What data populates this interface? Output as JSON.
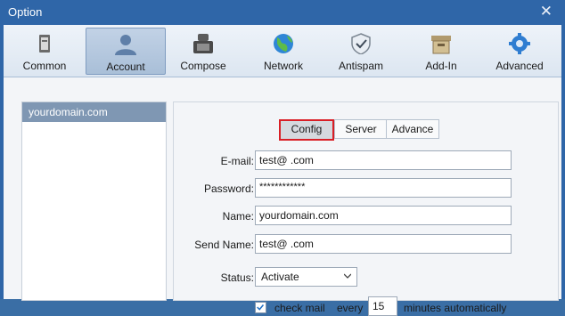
{
  "window": {
    "title": "Option"
  },
  "toolbar": {
    "items": [
      {
        "label": "Common",
        "icon": "common-icon"
      },
      {
        "label": "Account",
        "icon": "account-icon",
        "active": true
      },
      {
        "label": "Compose",
        "icon": "compose-icon"
      },
      {
        "label": "Network",
        "icon": "network-globe-icon"
      },
      {
        "label": "Antispam",
        "icon": "shield-icon"
      },
      {
        "label": "Add-In",
        "icon": "box-icon"
      },
      {
        "label": "Advanced",
        "icon": "gear-icon"
      }
    ]
  },
  "accounts": {
    "items": [
      "yourdomain.com"
    ]
  },
  "tabs": {
    "config": "Config",
    "server": "Server",
    "advance": "Advance",
    "selected": "Config"
  },
  "form": {
    "email_label": "E-mail:",
    "email_value": "test@               .com",
    "password_label": "Password:",
    "password_value": "************",
    "name_label": "Name:",
    "name_value": "yourdomain.com",
    "sendname_label": "Send Name:",
    "sendname_value": "test@               .com",
    "status_label": "Status:",
    "status_value": "Activate",
    "check_label": "check mail",
    "every_label": "every",
    "minutes_value": "15",
    "minutes_label": "minutes automatically",
    "check_checked": true
  },
  "colors": {
    "titlebar": "#2f66a8",
    "selection": "#7f97b3",
    "highlight": "#d91f26"
  }
}
